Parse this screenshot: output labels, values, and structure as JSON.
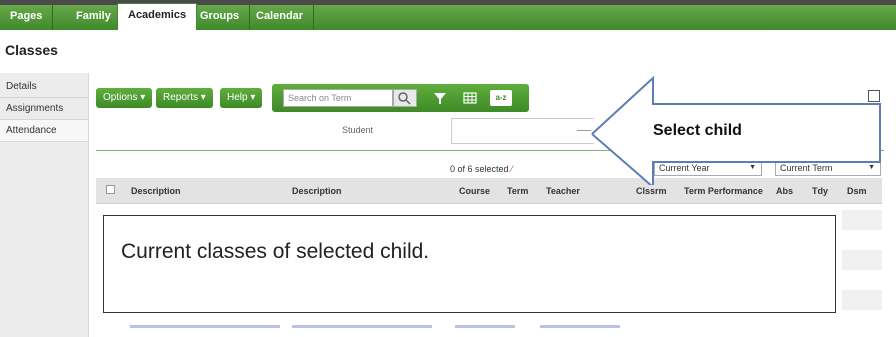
{
  "nav": {
    "tabs": [
      {
        "label": "Pages"
      },
      {
        "label": "Family"
      },
      {
        "label": "Academics"
      },
      {
        "label": "Groups"
      },
      {
        "label": "Calendar"
      }
    ],
    "active_tab": "Academics"
  },
  "page": {
    "title": "Classes"
  },
  "sidebar": {
    "items": [
      {
        "label": "Details"
      },
      {
        "label": "Assignments"
      },
      {
        "label": "Attendance"
      }
    ]
  },
  "toolbar": {
    "options_label": "Options",
    "reports_label": "Reports",
    "help_label": "Help",
    "search_placeholder": "Search on Term",
    "sort_label": "a-z"
  },
  "student": {
    "label": "Student",
    "value": ""
  },
  "selection": {
    "count_text": "0 of 6 selected"
  },
  "filters": {
    "year": "Current Year",
    "term": "Current Term"
  },
  "table": {
    "columns": [
      "Description",
      "Description",
      "Course",
      "Term",
      "Teacher",
      "Clssrm",
      "Term Performance",
      "Abs",
      "Tdy",
      "Dsm"
    ]
  },
  "annotations": {
    "arrow_label": "Select child",
    "box_text": "Current classes of selected child."
  },
  "colors": {
    "nav_green": "#4f9a35",
    "button_green": "#4d9c32"
  }
}
